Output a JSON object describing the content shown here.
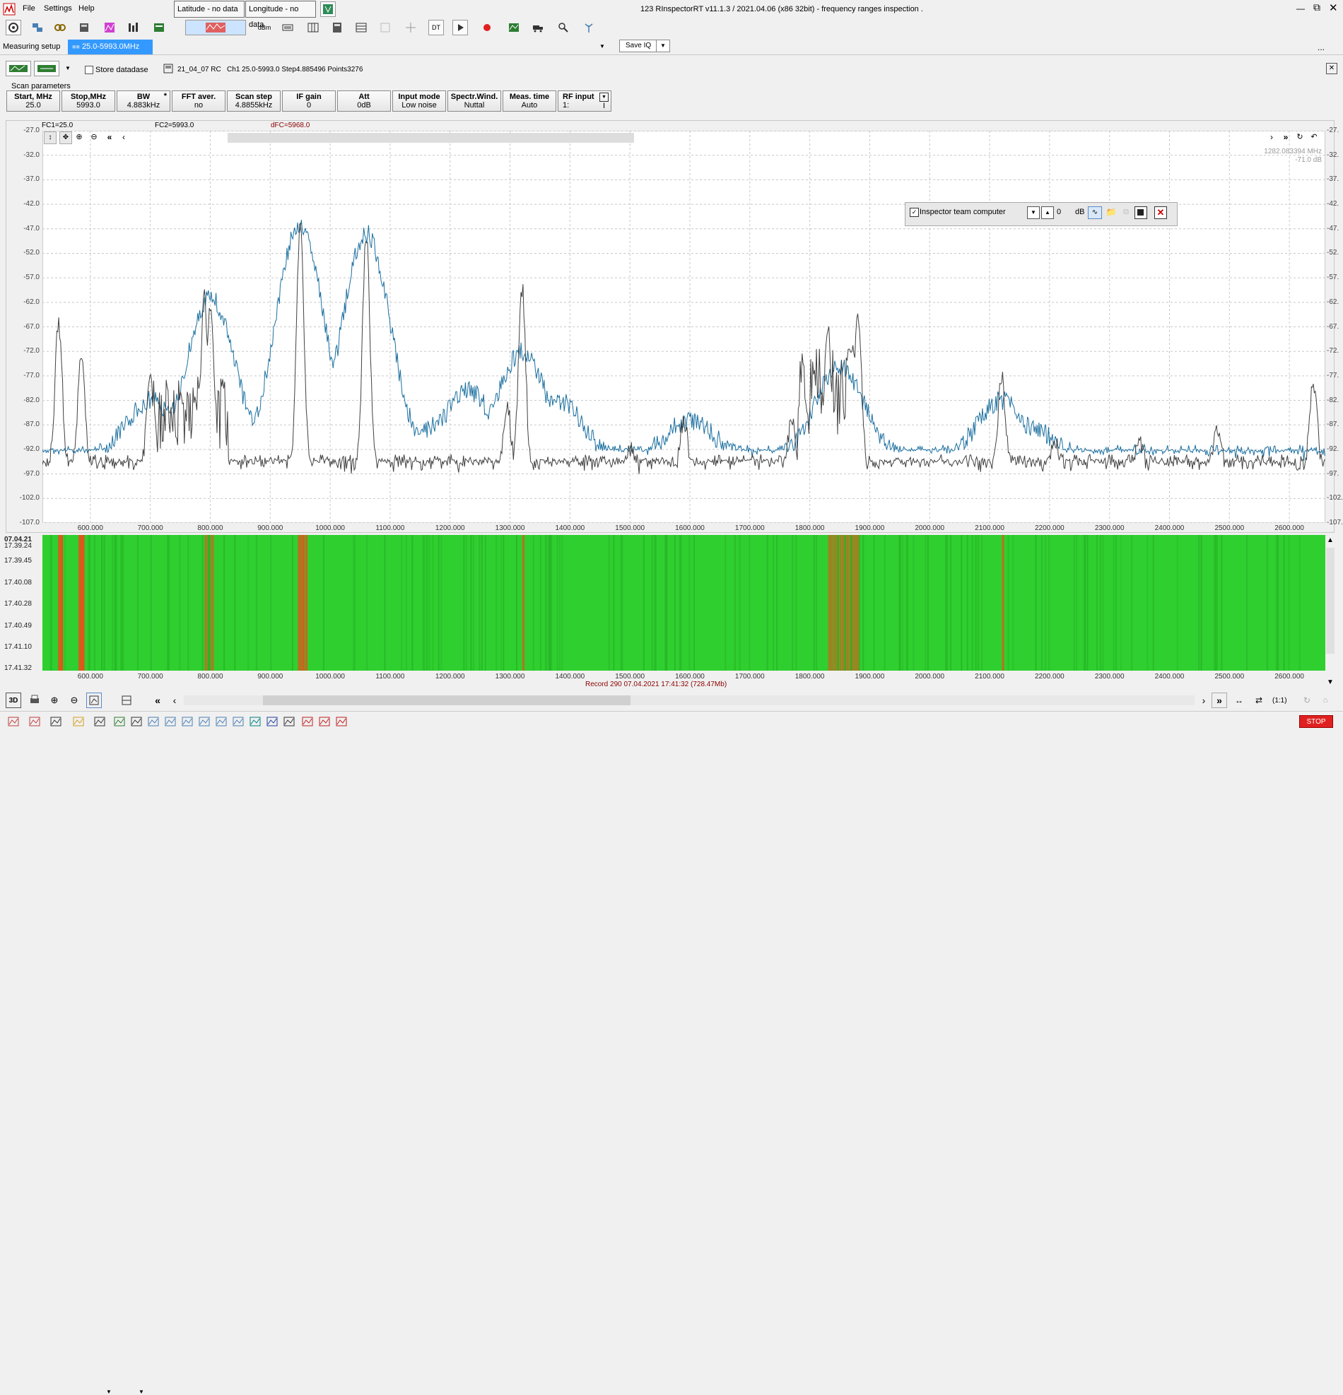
{
  "window": {
    "title": "123 RInspectorRT v11.1.3 / 2021.04.06 (x86 32bit) - frequency ranges inspection .",
    "controls": [
      "minimize",
      "restore",
      "close"
    ]
  },
  "menu": [
    "File",
    "Settings",
    "Help"
  ],
  "toolbar": {
    "latitude": "Latitude - no data",
    "longitude": "Longitude - no data",
    "dbm_label": "dBm",
    "dt_label": "DT",
    "saveiq_label": "Save IQ"
  },
  "tabs": [
    {
      "label": "Measuring setup",
      "active": false
    },
    {
      "label": "25.0-5993.0MHz",
      "active": true
    }
  ],
  "more_label": "...",
  "row2": {
    "store_label": "Store datadase",
    "store_checked": false,
    "file_info": "21_04_07 RC   Ch1 25.0-5993.0 Step4.885496 Points3276",
    "close": "✕"
  },
  "scan": {
    "group_label": "Scan parameters",
    "params": [
      {
        "title": "Start, MHz",
        "value": "25.0"
      },
      {
        "title": "Stop,MHz",
        "value": "5993.0"
      },
      {
        "title": "BW",
        "value": "4.883kHz",
        "mark": "*"
      },
      {
        "title": "FFT aver.",
        "value": "no"
      },
      {
        "title": "Scan step",
        "value": "4.8855kHz"
      },
      {
        "title": "IF gain",
        "value": "0"
      },
      {
        "title": "Att",
        "value": "0dB"
      },
      {
        "title": "Input mode",
        "value": "Low noise"
      },
      {
        "title": "Spectr.Wind.",
        "value": "Nuttal"
      },
      {
        "title": "Meas. time",
        "value": "Auto"
      },
      {
        "title": "RF input",
        "value": "1:",
        "extra": "I"
      }
    ]
  },
  "spectrum": {
    "fc1": "FC1=25.0",
    "fc2": "FC2=5993.0",
    "dfc": "dFC=5968.0",
    "cursor_freq": "1282.083394 MHz",
    "cursor_level": "-71.0 dB",
    "y_ticks": [
      "-27.0",
      "-32.0",
      "-37.0",
      "-42.0",
      "-47.0",
      "-52.0",
      "-57.0",
      "-62.0",
      "-67.0",
      "-72.0",
      "-77.0",
      "-82.0",
      "-87.0",
      "-92.0",
      "-97.0",
      "-102.0",
      "-107.0"
    ],
    "y_ticks_right": [
      "-27.",
      "-32.",
      "-37.",
      "-42.",
      "-47.",
      "-52.",
      "-57.",
      "-62.",
      "-67.",
      "-72.",
      "-77.",
      "-82.",
      "-87.",
      "-92.",
      "-97.",
      "-102.",
      "-107."
    ],
    "x_ticks": [
      "600.000",
      "700.000",
      "800.000",
      "900.000",
      "1000.000",
      "1100.000",
      "1200.000",
      "1300.000",
      "1400.000",
      "1500.000",
      "1600.000",
      "1700.000",
      "1800.000",
      "1900.000",
      "2000.000",
      "2100.000",
      "2200.000",
      "2300.000",
      "2400.000",
      "2500.000",
      "2600.000"
    ],
    "ylim": [
      -107,
      -27
    ],
    "xlim": [
      520,
      2660
    ]
  },
  "inspector": {
    "label": "Inspector team computer",
    "checked": true,
    "value": "0",
    "unit": "dB"
  },
  "waterfall": {
    "time_labels": [
      "07.04.21",
      "17.39.24",
      "17.39.45",
      "17.40.08",
      "17.40.28",
      "17.40.49",
      "17.41.10",
      "17.41.32"
    ],
    "x_ticks": [
      "600.000",
      "700.000",
      "800.000",
      "900.000",
      "1000.000",
      "1100.000",
      "1200.000",
      "1300.000",
      "1400.000",
      "1500.000",
      "1600.000",
      "1700.000",
      "1800.000",
      "1900.000",
      "2000.000",
      "2100.000",
      "2200.000",
      "2300.000",
      "2400.000",
      "2500.000",
      "2600.000"
    ],
    "record": "Record 290 07.04.2021 17:41:32 (728.47Mb)"
  },
  "bottom_bar": {
    "ratio": "(1:1)",
    "threed": "3D"
  },
  "stop_label": "STOP",
  "colors": {
    "trace_blue": "#1a6fa0",
    "trace_dark": "#404040",
    "waterfall_green": "#2fcf2f",
    "waterfall_red": "#e8501a",
    "tab_active": "#3399ff",
    "stop": "#e02020"
  },
  "chart_data": {
    "type": "line",
    "xlabel": "",
    "ylabel": "",
    "xlim": [
      520,
      2660
    ],
    "ylim": [
      -107,
      -27
    ],
    "grid": true,
    "series": [
      {
        "peaks_mhz": [
          547,
          585,
          700,
          790,
          800,
          950,
          1060,
          1295,
          1320,
          1500,
          1590,
          1770,
          1830,
          1870,
          1880,
          2120,
          2210,
          2350,
          2480,
          2640
        ],
        "peak_db": [
          -66,
          -72,
          -78,
          -61,
          -63,
          -46,
          -48,
          -83,
          -59,
          -92,
          -86,
          -86,
          -67,
          -71,
          -64,
          -77,
          -90,
          -91,
          -88,
          -78
        ],
        "floor_db": -96
      },
      {
        "peaks_mhz": [
          700,
          790,
          800,
          950,
          1060,
          1230,
          1320,
          1380,
          1600,
          1850,
          2120,
          2170
        ],
        "peak_db": [
          -82,
          -78,
          -61,
          -46,
          -48,
          -80,
          -72,
          -82,
          -86,
          -75,
          -82,
          -88
        ],
        "floor_db": -94
      }
    ]
  }
}
